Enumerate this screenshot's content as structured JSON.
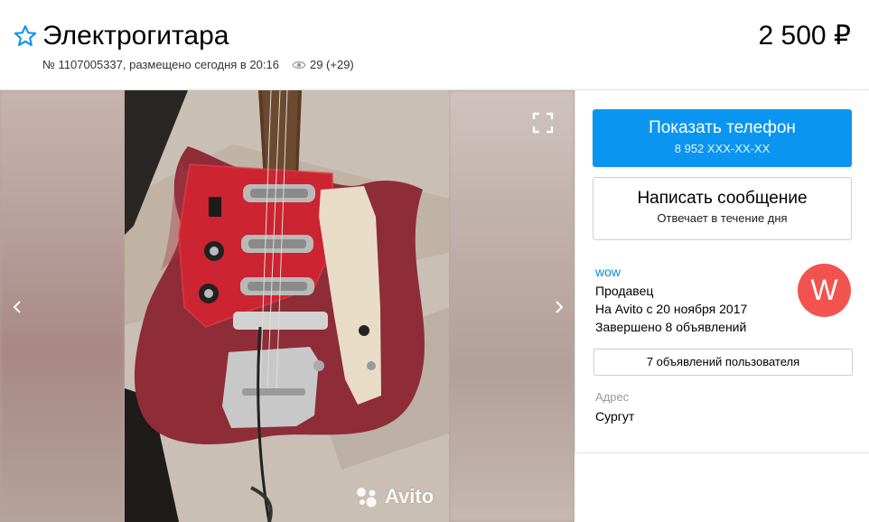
{
  "listing": {
    "title": "Электрогитара",
    "price": "2 500 ₽",
    "meta_text": "№ 1107005337, размещено сегодня в 20:16",
    "views": "29 (+29)"
  },
  "gallery": {
    "watermark": "Avito"
  },
  "contact": {
    "phone_label": "Показать телефон",
    "phone_number": "8 952 XXX-XX-XX",
    "message_label": "Написать сообщение",
    "message_sub": "Отвечает в течение дня"
  },
  "seller": {
    "name": "wow",
    "role": "Продавец",
    "since": "На Avito с 20 ноября 2017",
    "completed": "Завершено 8 объявлений",
    "avatar_letter": "W",
    "ads_button": "7 объявлений пользователя"
  },
  "address": {
    "label": "Адрес",
    "value": "Сургут"
  },
  "colors": {
    "accent_blue": "#0a95f0",
    "link_blue": "#0a88dd",
    "avatar_red": "#f2534f"
  },
  "icons": [
    "star-icon",
    "eye-icon",
    "arrow-left-icon",
    "arrow-right-icon",
    "fullscreen-icon",
    "avito-logo-icon"
  ]
}
